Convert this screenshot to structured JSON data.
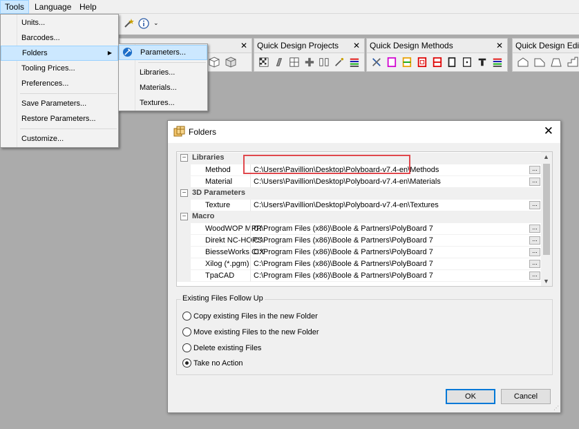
{
  "menubar": {
    "items": [
      "Tools",
      "Language",
      "Help"
    ]
  },
  "tools_menu": {
    "items": [
      "Units...",
      "Barcodes...",
      "Folders",
      "Tooling Prices...",
      "Preferences...",
      "Save Parameters...",
      "Restore Parameters...",
      "Customize..."
    ]
  },
  "folders_submenu": {
    "items": [
      "Parameters...",
      "Libraries...",
      "Materials...",
      "Textures..."
    ]
  },
  "toolbars": {
    "quick_design_projects": "Quick Design Projects",
    "quick_design_methods": "Quick Design Methods",
    "quick_design_edit": "Quick Design Edit",
    "close_glyph": "✕"
  },
  "dialog": {
    "title": "Folders",
    "close_glyph": "✕",
    "grid": {
      "categories": [
        "Libraries",
        "3D Parameters",
        "Macro"
      ],
      "libraries": [
        {
          "key": "Method",
          "value": "C:\\Users\\Pavillion\\Desktop\\Polyboard-v7.4-en\\Methods"
        },
        {
          "key": "Material",
          "value": "C:\\Users\\Pavillion\\Desktop\\Polyboard-v7.4-en\\Materials"
        }
      ],
      "parameters_3d": [
        {
          "key": "Texture",
          "value": "C:\\Users\\Pavillion\\Desktop\\Polyboard-v7.4-en\\Textures"
        }
      ],
      "macro": [
        {
          "key": "WoodWOP MPR",
          "value": "C:\\Program Files (x86)\\Boole & Partners\\PolyBoard 7"
        },
        {
          "key": "Direkt NC-HOPS",
          "value": "C:\\Program Files (x86)\\Boole & Partners\\PolyBoard 7"
        },
        {
          "key": "BiesseWorks CIX",
          "value": "C:\\Program Files (x86)\\Boole & Partners\\PolyBoard 7"
        },
        {
          "key": "Xilog (*.pgm)",
          "value": "C:\\Program Files (x86)\\Boole & Partners\\PolyBoard 7"
        },
        {
          "key": "TpaCAD",
          "value": "C:\\Program Files (x86)\\Boole & Partners\\PolyBoard 7"
        }
      ],
      "ellipsis": "...",
      "toggle": "−"
    },
    "group": {
      "label": "Existing Files Follow Up",
      "options": [
        "Copy existing Files in the new Folder",
        "Move existing Files to the new Folder",
        "Delete existing Files",
        "Take no Action"
      ],
      "selected": "Take no Action"
    },
    "ok": "OK",
    "cancel": "Cancel"
  },
  "colors": {
    "highlight_box": "#e0474c",
    "menu_highlight": "#cce8ff",
    "default_button": "#0078d7"
  }
}
